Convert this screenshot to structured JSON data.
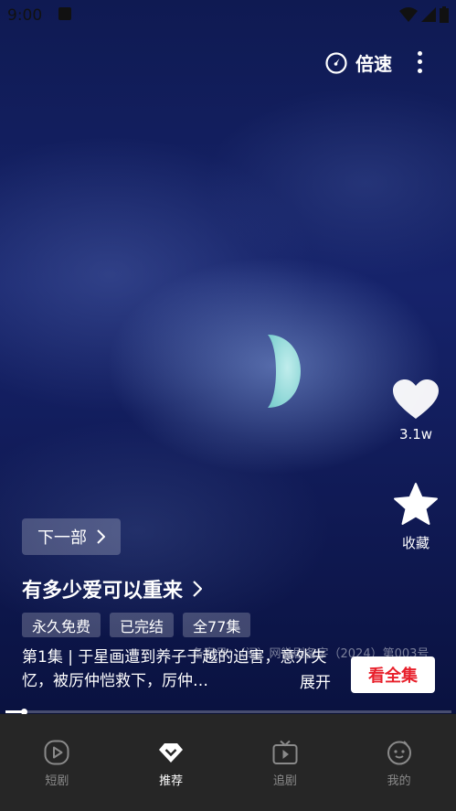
{
  "status_bar": {
    "time": "9:00"
  },
  "top_bar": {
    "speed_label": "倍速"
  },
  "side_actions": {
    "like_count": "3.1w",
    "favorite_label": "收藏"
  },
  "drama": {
    "next_label": "下一部",
    "title": "有多少爱可以重来",
    "tags": [
      "永久免费",
      "已完结",
      "全77集"
    ],
    "license_text": "备案号：（闽）网微剧备字（2024）第003号",
    "description": "第1集 | 于星画遭到养子于越的迫害，意外失忆，被厉仲恺救下，厉仲…",
    "expand_label": "展开",
    "watch_all_label": "看全集"
  },
  "progress": {
    "value": 0.04
  },
  "bottom_nav": {
    "items": [
      {
        "label": "短剧",
        "icon": "play-circle-icon",
        "active": false
      },
      {
        "label": "推荐",
        "icon": "diamond-icon",
        "active": true
      },
      {
        "label": "追剧",
        "icon": "tv-icon",
        "active": false
      },
      {
        "label": "我的",
        "icon": "smile-face-icon",
        "active": false
      }
    ]
  },
  "colors": {
    "accent_red": "#e8202b",
    "nav_bg": "#262626"
  }
}
